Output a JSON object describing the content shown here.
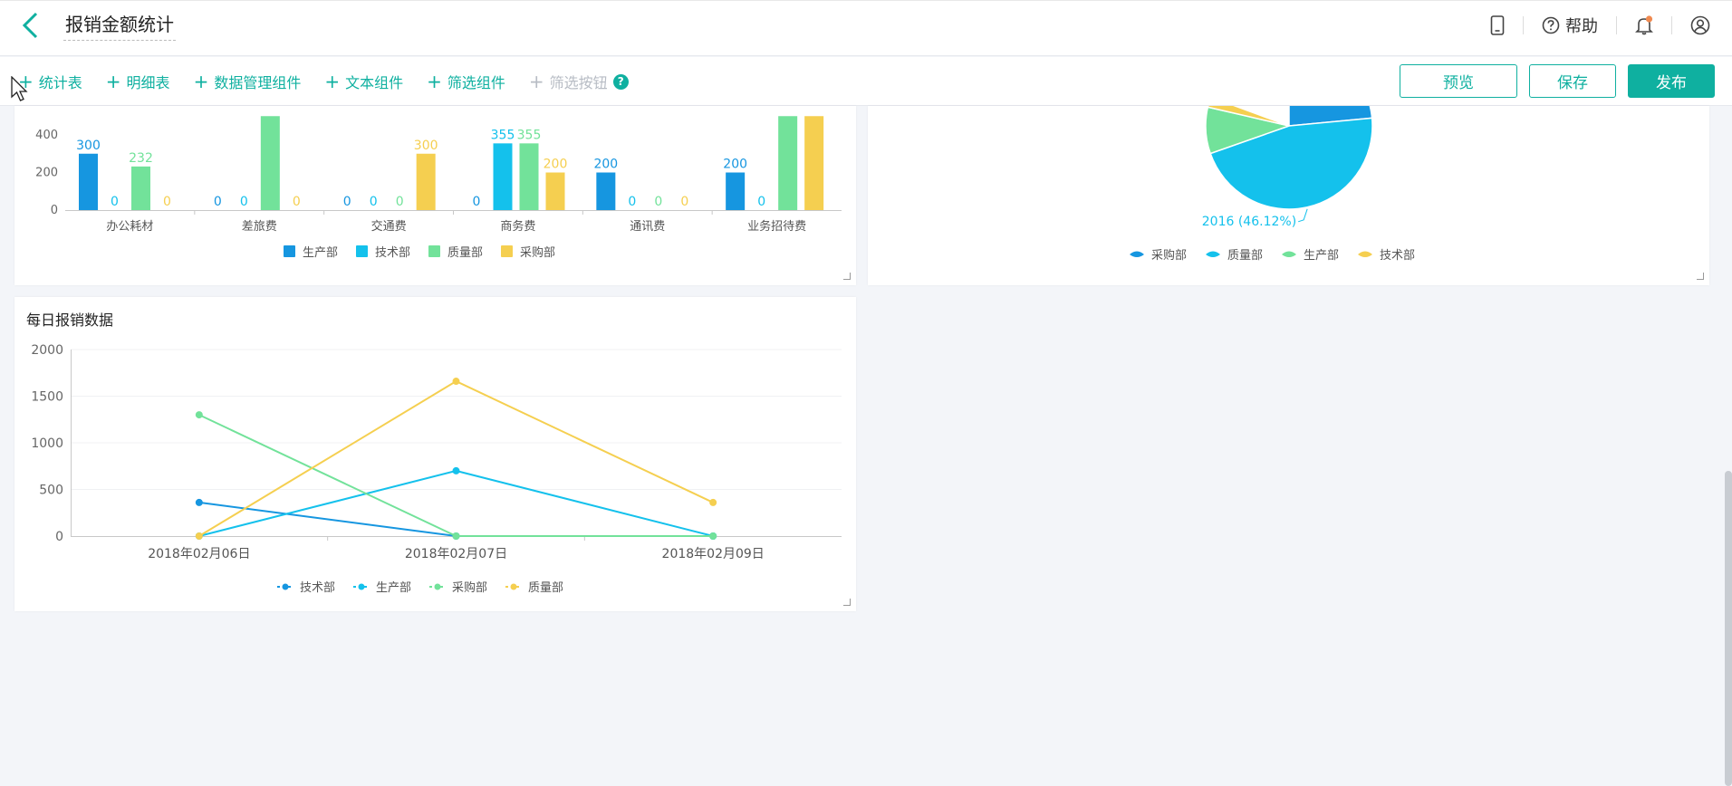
{
  "header": {
    "title": "报销金额统计",
    "help_label": "帮助"
  },
  "toolbar": {
    "items": [
      {
        "label": "统计表"
      },
      {
        "label": "明细表"
      },
      {
        "label": "数据管理组件"
      },
      {
        "label": "文本组件"
      },
      {
        "label": "筛选组件"
      },
      {
        "label": "筛选按钮"
      }
    ],
    "preview_label": "预览",
    "save_label": "保存",
    "publish_label": "发布"
  },
  "colors": {
    "accent": "#0fb0a0",
    "dark_blue": "#1696e0",
    "light_blue": "#14c1ec",
    "green": "#72e29a",
    "yellow": "#f5cf50"
  },
  "chart_data": [
    {
      "type": "bar",
      "categories": [
        "办公耗材",
        "差旅费",
        "交通费",
        "商务费",
        "通讯费",
        "业务招待费"
      ],
      "ylim": [
        0,
        450
      ],
      "yticks": [
        0,
        200,
        400
      ],
      "series": [
        {
          "name": "生产部",
          "color": "#1696e0",
          "values": [
            300,
            0,
            0,
            0,
            200,
            200
          ],
          "labels": [
            "300",
            "0",
            "0",
            "0",
            "200",
            "200"
          ]
        },
        {
          "name": "技术部",
          "color": "#14c1ec",
          "values": [
            0,
            0,
            0,
            355,
            0,
            0
          ],
          "labels": [
            "0",
            "0",
            "0",
            "355",
            "0",
            "0"
          ]
        },
        {
          "name": "质量部",
          "color": "#72e29a",
          "values": [
            232,
            500,
            0,
            355,
            0,
            500
          ],
          "labels": [
            "232",
            "",
            "0",
            "355",
            "0",
            ""
          ]
        },
        {
          "name": "采购部",
          "color": "#f5cf50",
          "values": [
            0,
            0,
            300,
            200,
            0,
            500
          ],
          "labels": [
            "0",
            "0",
            "300",
            "200",
            "0",
            ""
          ]
        }
      ]
    },
    {
      "type": "pie",
      "slices": [
        {
          "name": "采购部",
          "color": "#1696e0",
          "value": 23.5
        },
        {
          "name": "质量部",
          "color": "#14c1ec",
          "value": 46.12,
          "label": "2016 (46.12%)"
        },
        {
          "name": "生产部",
          "color": "#72e29a",
          "value": 9
        },
        {
          "name": "技术部",
          "color": "#f5cf50",
          "value": 2
        }
      ]
    },
    {
      "type": "line",
      "title": "每日报销数据",
      "x": [
        "2018年02月06日",
        "2018年02月07日",
        "2018年02月09日"
      ],
      "ylim": [
        0,
        2000
      ],
      "yticks": [
        0,
        500,
        1000,
        1500,
        2000
      ],
      "series": [
        {
          "name": "技术部",
          "color": "#1696e0",
          "values": [
            360,
            0,
            0
          ]
        },
        {
          "name": "生产部",
          "color": "#14c1ec",
          "values": [
            0,
            700,
            0
          ]
        },
        {
          "name": "采购部",
          "color": "#72e29a",
          "values": [
            1300,
            0,
            0
          ]
        },
        {
          "name": "质量部",
          "color": "#f5cf50",
          "values": [
            0,
            1660,
            360
          ]
        }
      ]
    }
  ]
}
